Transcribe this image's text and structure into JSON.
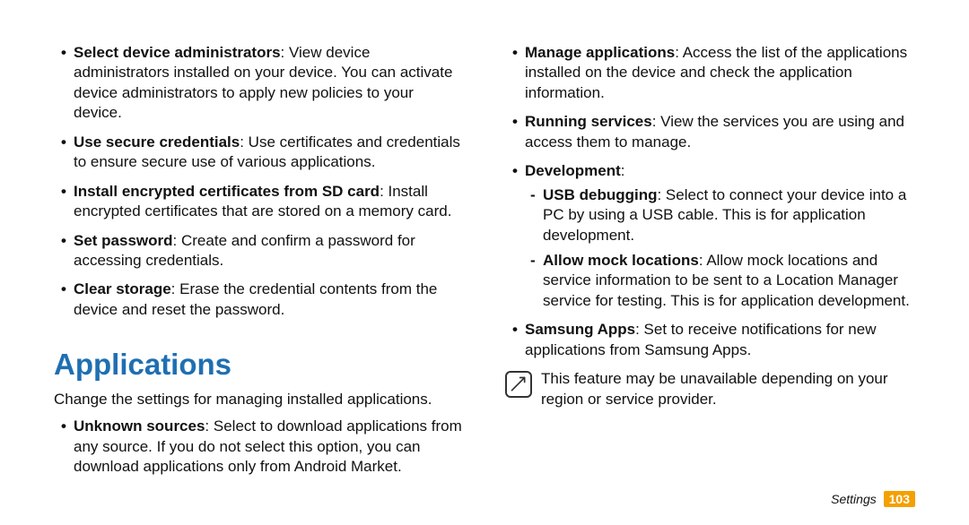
{
  "left": {
    "items": [
      {
        "bold": "Select device administrators",
        "text": ": View device administrators installed on your device. You can activate device administrators to apply new policies to your device."
      },
      {
        "bold": "Use secure credentials",
        "text": ": Use certificates and credentials to ensure secure use of various applications."
      },
      {
        "bold": "Install encrypted certificates from SD card",
        "text": ": Install encrypted certificates that are stored on a memory card."
      },
      {
        "bold": "Set password",
        "text": ": Create and confirm a password for accessing credentials."
      },
      {
        "bold": "Clear storage",
        "text": ": Erase the credential contents from the device and reset the password."
      }
    ],
    "heading": "Applications",
    "intro": "Change the settings for managing installed applications.",
    "items2": [
      {
        "bold": "Unknown sources",
        "text": ": Select to download applications from any source. If you do not select this option, you can download applications only from Android Market."
      }
    ]
  },
  "right": {
    "items": [
      {
        "bold": "Manage applications",
        "text": ": Access the list of the applications installed on the device and check the application information."
      },
      {
        "bold": "Running services",
        "text": ": View the services you are using and access them to manage."
      }
    ],
    "dev_label": "Development",
    "dev_colon": ":",
    "dev_sub": [
      {
        "bold": "USB debugging",
        "text": ": Select to connect your device into a PC by using a USB cable. This is for application development."
      },
      {
        "bold": "Allow mock locations",
        "text": ": Allow mock locations and service information to be sent to a Location Manager service for testing. This is for application development."
      }
    ],
    "items2": [
      {
        "bold": "Samsung Apps",
        "text": ": Set to receive notifications for new applications from Samsung Apps."
      }
    ],
    "note": "This feature may be unavailable depending on your region or service provider."
  },
  "footer": {
    "section": "Settings",
    "page": "103"
  }
}
